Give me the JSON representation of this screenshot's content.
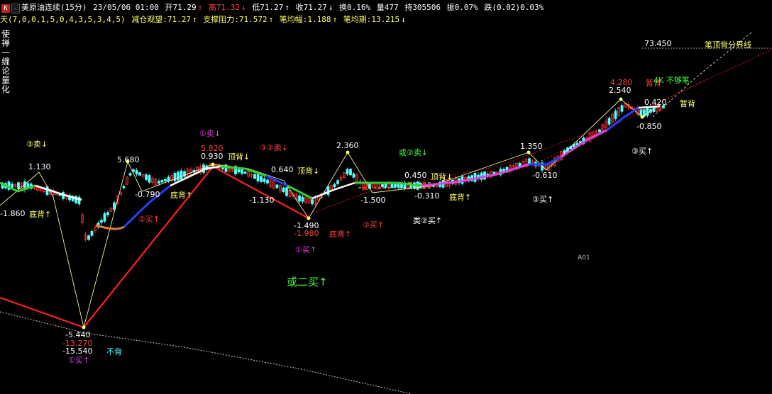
{
  "header": {
    "k_button": "K",
    "dash_button": "-",
    "symbol": "美原油连续(15分)",
    "datetime": "23/05/06 01:00",
    "open": "开71.29",
    "high": "高71.32",
    "low": "低71.27",
    "close": "收71.27",
    "turnover": "换0.16%",
    "volume": "量477",
    "hold": "持305506",
    "amplitude": "振0.07%",
    "change": "跌(0.02)0.03%"
  },
  "indicator": {
    "name": "天(7,0,0,1,5,0,4,3,5,3,4,5)",
    "reduce": "减仓观望:71.27",
    "support": "支撑阻力:71.572",
    "stroke_amp": "笔均幅:1.188",
    "stroke_period": "笔均期:13.215"
  },
  "sidebar": {
    "vertical_text": "使禅—缠论量化"
  },
  "colors": {
    "up_candle": "#ff3030",
    "down_candle": "#54ffff",
    "up_arrow": "#ff4040",
    "down_arrow": "#40ff40",
    "yellow": "#ffff66",
    "magenta": "#e040e0"
  },
  "labels": [
    {
      "id": "val-1130",
      "text": "1.130",
      "color": "#ffffff"
    },
    {
      "id": "sell3-a",
      "text": "③卖↓",
      "color": "#ffff66"
    },
    {
      "id": "val-n1860",
      "text": "-1.860",
      "color": "#ffffff"
    },
    {
      "id": "bottom-div-a",
      "text": "底背↑",
      "color": "#ffff66"
    },
    {
      "id": "val-5680",
      "text": "5.680",
      "color": "#ffffff"
    },
    {
      "id": "val-n0790",
      "text": "-0.790",
      "color": "#ffffff"
    },
    {
      "id": "bottom-div-b",
      "text": "底背↑",
      "color": "#ffff66"
    },
    {
      "id": "buy2-a",
      "text": "②买↑",
      "color": "#ff4040"
    },
    {
      "id": "sell1",
      "text": "①卖↓",
      "color": "#e040e0"
    },
    {
      "id": "val-5820",
      "text": "5.820",
      "color": "#ff4040"
    },
    {
      "id": "val-0930",
      "text": "0.930",
      "color": "#ffffff"
    },
    {
      "id": "top-div-a",
      "text": "顶背↓",
      "color": "#ffff66"
    },
    {
      "id": "sell2",
      "text": "③②卖↓",
      "color": "#ff4040"
    },
    {
      "id": "val-0640",
      "text": "0.640",
      "color": "#ffffff"
    },
    {
      "id": "top-div-b",
      "text": "顶背↓",
      "color": "#ffff66"
    },
    {
      "id": "val-n1130",
      "text": "-1.130",
      "color": "#ffffff"
    },
    {
      "id": "val-2360",
      "text": "2.360",
      "color": "#ffffff"
    },
    {
      "id": "or-sell2",
      "text": "或②卖↓",
      "color": "#40ff40"
    },
    {
      "id": "val-0450",
      "text": "0.450",
      "color": "#ffffff"
    },
    {
      "id": "top-div-c",
      "text": "顶背↓",
      "color": "#ffff66"
    },
    {
      "id": "val-n1500",
      "text": "-1.500",
      "color": "#ffffff"
    },
    {
      "id": "val-n0310",
      "text": "-0.310",
      "color": "#ffffff"
    },
    {
      "id": "bottom-div-c",
      "text": "底背↑",
      "color": "#ffff66"
    },
    {
      "id": "val-n1490",
      "text": "-1.490",
      "color": "#ffffff"
    },
    {
      "id": "val-n1980",
      "text": "-1.980",
      "color": "#ff4040"
    },
    {
      "id": "bottom-div-d",
      "text": "底背↑",
      "color": "#ff4040"
    },
    {
      "id": "buy2-b",
      "text": "②买↑",
      "color": "#ff4040"
    },
    {
      "id": "class-buy2",
      "text": "类②买↑",
      "color": "#ffffff"
    },
    {
      "id": "buy1-a",
      "text": "①买↑",
      "color": "#e040e0"
    },
    {
      "id": "or-buy2",
      "text": "或二买↑",
      "color": "#40ff40"
    },
    {
      "id": "val-1350",
      "text": "1.350",
      "color": "#ffffff"
    },
    {
      "id": "val-n0610",
      "text": "-0.610",
      "color": "#ffffff"
    },
    {
      "id": "buy3-a",
      "text": "③买↑",
      "color": "#ffffff"
    },
    {
      "id": "val-4280",
      "text": "4.280",
      "color": "#ff4040"
    },
    {
      "id": "val-2540",
      "text": "2.540",
      "color": "#ffffff"
    },
    {
      "id": "temp-div-a",
      "text": "暂背",
      "color": "#ff4040"
    },
    {
      "id": "not-enough",
      "text": "4K 不够笔",
      "color": "#40ff40"
    },
    {
      "id": "val-0420",
      "text": "0.420",
      "color": "#ffffff"
    },
    {
      "id": "temp-div-b",
      "text": "暂背",
      "color": "#ffff66"
    },
    {
      "id": "val-n0850",
      "text": "-0.850",
      "color": "#ffffff"
    },
    {
      "id": "buy3-b",
      "text": "③买↑",
      "color": "#ffffff"
    },
    {
      "id": "val-73450",
      "text": "73.450",
      "color": "#ffffff"
    },
    {
      "id": "stroke-line",
      "text": "笔顶背分界线",
      "color": "#ffff66"
    },
    {
      "id": "a01",
      "text": "A01",
      "color": "#bbbbbb"
    },
    {
      "id": "val-n5440",
      "text": "-5.440",
      "color": "#ffffff"
    },
    {
      "id": "val-n13270",
      "text": "-13.270",
      "color": "#ff4040"
    },
    {
      "id": "val-n15540",
      "text": "-15.540",
      "color": "#ffffff"
    },
    {
      "id": "no-div",
      "text": "不背",
      "color": "#54ffff"
    },
    {
      "id": "buy1-b",
      "text": "①买↑",
      "color": "#e040e0"
    }
  ]
}
